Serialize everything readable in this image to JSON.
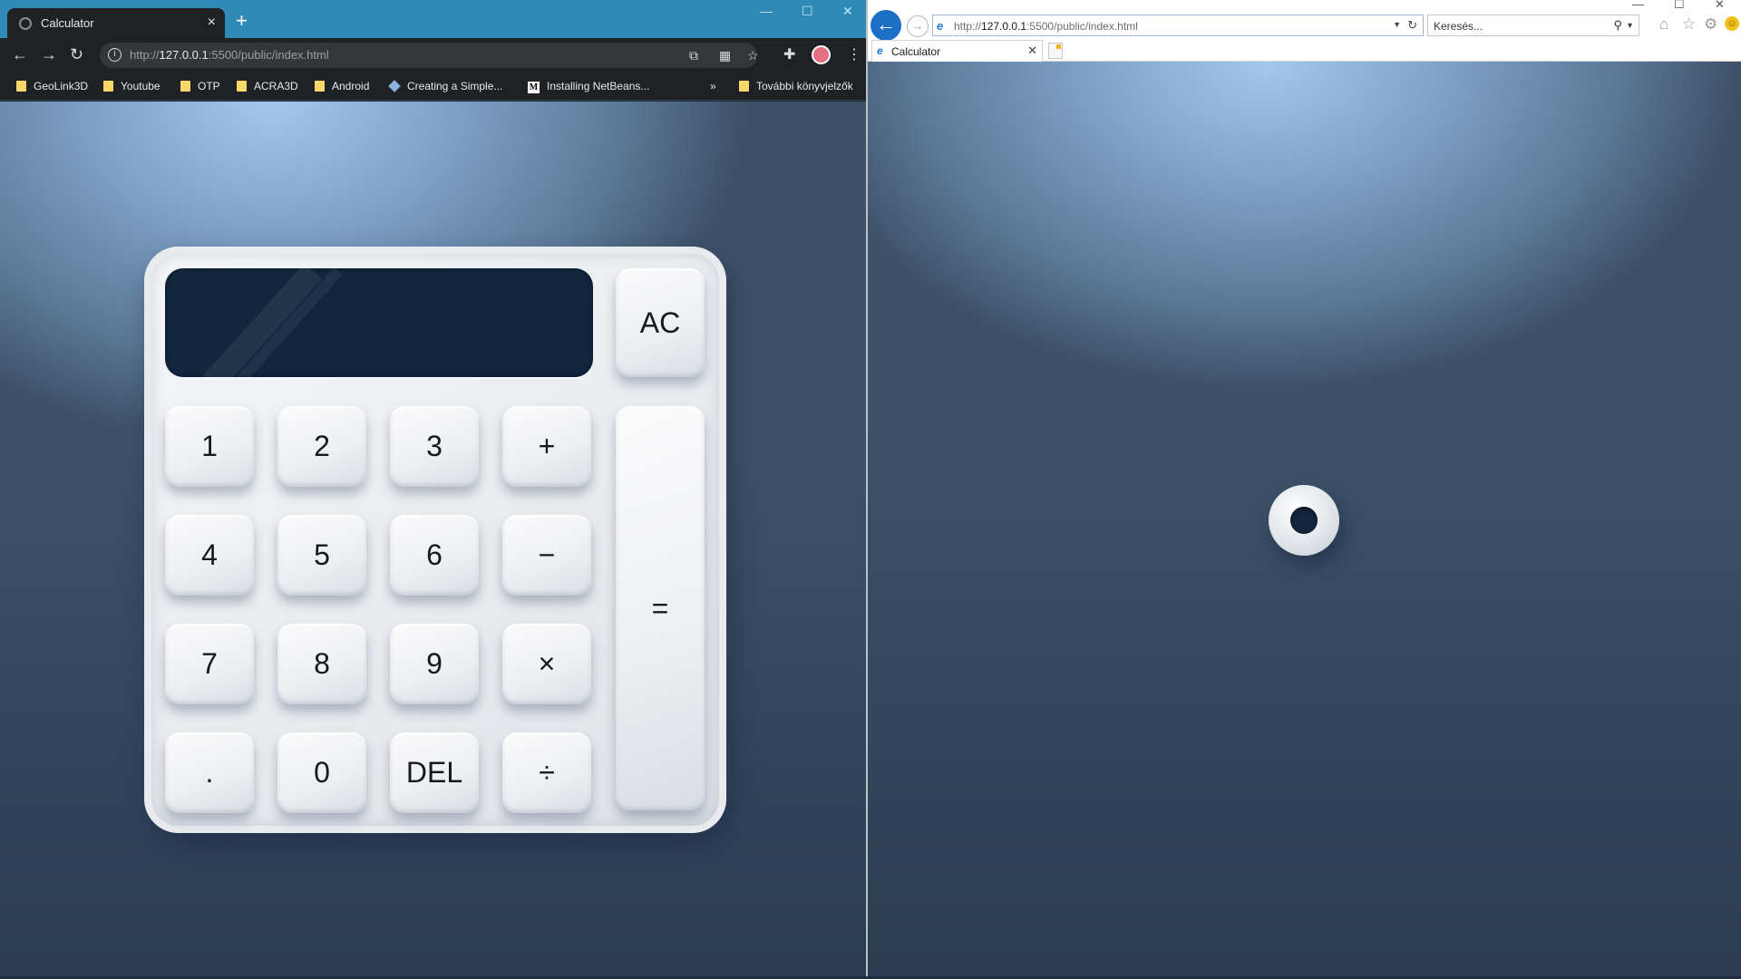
{
  "chrome": {
    "tab_title": "Calculator",
    "tab_close": "×",
    "new_tab": "+",
    "window_controls": [
      "—",
      "☐",
      "✕"
    ],
    "url_prefix": "http://",
    "url_host": "127.0.0.1",
    "url_rest": ":5500/public/index.html",
    "bookmarks": [
      "GeoLink3D",
      "Youtube",
      "OTP",
      "ACRA3D",
      "Android",
      "Creating a Simple...",
      "Installing NetBeans..."
    ],
    "bookmarks_more": "»",
    "other_bookmarks": "További könyvjelzők"
  },
  "calculator": {
    "display_value": "",
    "keys": {
      "ac": "AC",
      "equals": "=",
      "grid": [
        "1",
        "2",
        "3",
        "+",
        "4",
        "5",
        "6",
        "−",
        "7",
        "8",
        "9",
        "×",
        ".",
        "0",
        "DEL",
        "÷"
      ]
    }
  },
  "ie": {
    "url_prefix": "http://",
    "url_host": "127.0.0.1",
    "url_rest": ":5500/public/index.html",
    "search_placeholder": "Keresés...",
    "tab_title": "Calculator",
    "tab_close": "✕",
    "window_controls": [
      "—",
      "☐",
      "✕"
    ]
  },
  "icons": {
    "chrome": [
      "back-icon",
      "forward-icon",
      "reload-icon",
      "info-icon",
      "cast-icon",
      "qr-code-icon",
      "star-icon",
      "extensions-icon",
      "menu-icon"
    ],
    "ie": [
      "back-icon",
      "forward-icon",
      "refresh-icon",
      "search-icon",
      "home-icon",
      "favorites-icon",
      "settings-icon",
      "smiley-icon"
    ]
  },
  "colors": {
    "chrome_titlebar": "#2f8bb5",
    "display": "#12263e",
    "page_background": "#5b7896"
  }
}
